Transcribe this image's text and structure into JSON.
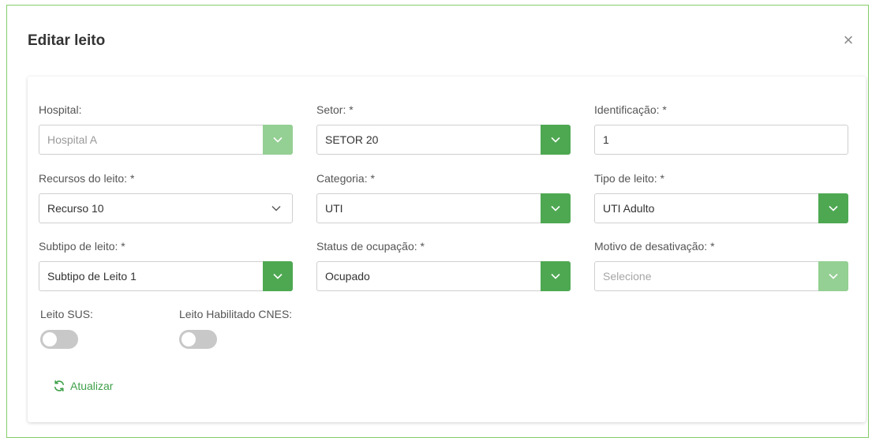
{
  "modal": {
    "title": "Editar leito",
    "close_glyph": "×"
  },
  "form": {
    "hospital": {
      "label": "Hospital:",
      "value": "Hospital A"
    },
    "setor": {
      "label": "Setor: *",
      "value": "SETOR 20"
    },
    "identificacao": {
      "label": "Identificação: *",
      "value": "1"
    },
    "recursos": {
      "label": "Recursos do leito: *",
      "value": "Recurso 10"
    },
    "categoria": {
      "label": "Categoria: *",
      "value": "UTI"
    },
    "tipo": {
      "label": "Tipo de leito: *",
      "value": "UTI Adulto"
    },
    "subtipo": {
      "label": "Subtipo de leito: *",
      "value": "Subtipo de Leito 1"
    },
    "status": {
      "label": "Status de ocupação: *",
      "value": "Ocupado"
    },
    "motivo": {
      "label": "Motivo de desativação: *",
      "placeholder": "Selecione"
    },
    "leito_sus": {
      "label": "Leito SUS:",
      "on": false
    },
    "leito_cnes": {
      "label": "Leito Habilitado CNES:",
      "on": false
    }
  },
  "actions": {
    "refresh_label": "Atualizar"
  },
  "colors": {
    "accent": "#4ea852",
    "accent_disabled": "#94cf93",
    "modal_border": "#86cc6a",
    "link": "#3fa14a"
  },
  "icons": {
    "close": "close-icon",
    "dropdown": "chevron-down-icon",
    "refresh": "refresh-icon"
  }
}
